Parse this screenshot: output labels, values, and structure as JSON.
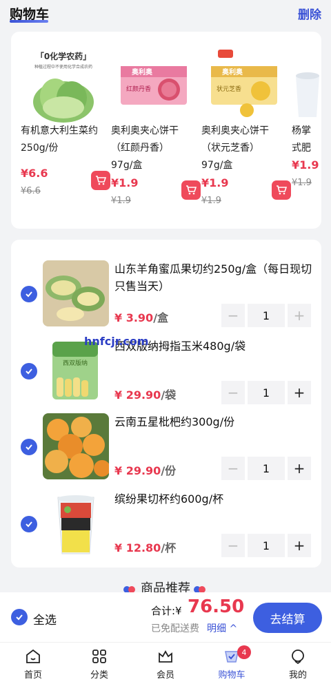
{
  "header": {
    "title": "购物车",
    "delete_label": "删除"
  },
  "recommendations": [
    {
      "img_text": "「0化学农药」",
      "img_sub": "种植过程中不使用化学合成农药",
      "name": "有机意大利生菜约\n250g/份",
      "price": "¥6.6",
      "old_price": "¥6.6"
    },
    {
      "img_text": "奥利奥",
      "img_sub": "红颜丹香",
      "name": "奥利奥夹心饼干\n（红颜丹香）\n97g/盒",
      "price": "¥1.9",
      "old_price": "¥1.9"
    },
    {
      "img_text": "奥利奥",
      "img_sub": "状元芝香",
      "name": "奥利奥夹心饼干\n（状元芝香）\n97g/盒",
      "price": "¥1.9",
      "old_price": "¥1.9"
    },
    {
      "img_text": "",
      "img_sub": "",
      "name": "杨掌\n式肥",
      "price": "¥1.9",
      "old_price": "¥1.9"
    }
  ],
  "cart": {
    "items": [
      {
        "name": "山东羊角蜜瓜果切约250g/盒（每日现切 只售当天）",
        "price": "¥ 3.90",
        "unit": "/盒",
        "qty": "1"
      },
      {
        "name": "西双版纳拇指玉米480g/袋",
        "overlay": "hnfcjr.com",
        "price": "¥ 29.90",
        "unit": "/袋",
        "qty": "1",
        "img_text": "西双版纳"
      },
      {
        "name": "云南五星枇杷约300g/份",
        "price": "¥ 29.90",
        "unit": "/份",
        "qty": "1"
      },
      {
        "name": "缤纷果切杯约600g/杯",
        "price": "¥ 12.80",
        "unit": "/杯",
        "qty": "1"
      }
    ]
  },
  "section": {
    "title": "商品推荐"
  },
  "checkout": {
    "select_all_label": "全选",
    "total_label": "合计:¥",
    "total_value": "76.50",
    "free_shipping": "已免配送费",
    "detail_label": "明细 ^",
    "pay_label": "去结算"
  },
  "tabbar": {
    "tabs": [
      {
        "label": "首页",
        "icon": "home-icon"
      },
      {
        "label": "分类",
        "icon": "category-icon"
      },
      {
        "label": "会员",
        "icon": "crown-icon"
      },
      {
        "label": "购物车",
        "icon": "cart-icon"
      },
      {
        "label": "我的",
        "icon": "user-icon"
      }
    ],
    "cart_badge": "4"
  },
  "colors": {
    "accent": "#3d5fe0",
    "price": "#e8384f"
  }
}
